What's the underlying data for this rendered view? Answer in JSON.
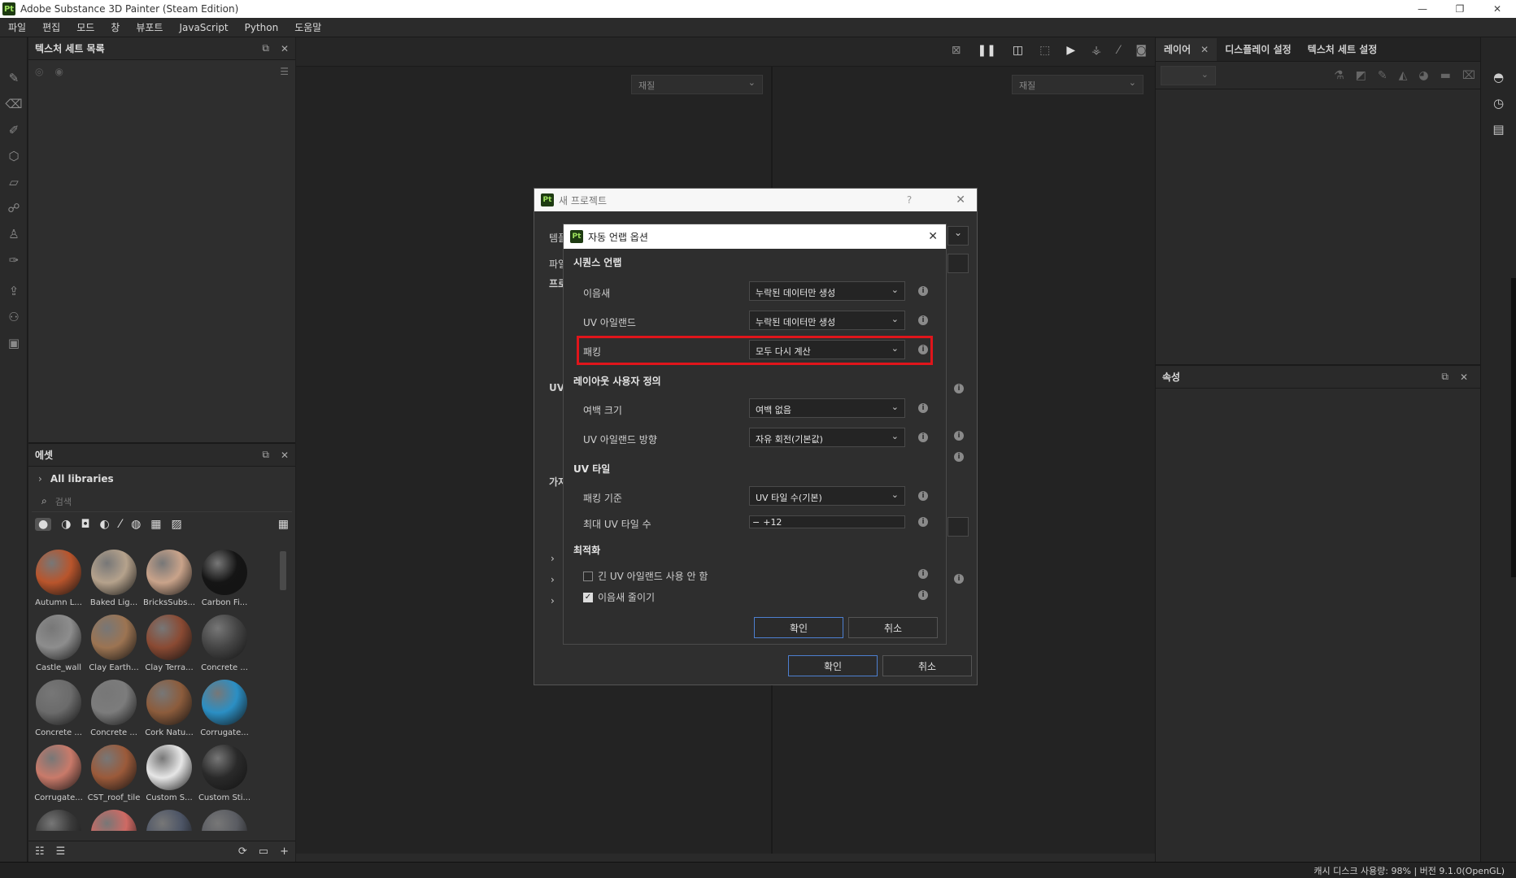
{
  "window": {
    "title": "Adobe Substance 3D Painter (Steam Edition)",
    "logo": "Pt",
    "min": "—",
    "max": "❐",
    "close": "✕"
  },
  "menu": [
    "파일",
    "편집",
    "모드",
    "창",
    "뷰포트",
    "JavaScript",
    "Python",
    "도움말"
  ],
  "texture_set_panel": {
    "title": "텍스처 세트 목록"
  },
  "assets_panel": {
    "title": "에셋",
    "libraries": "All libraries",
    "search_placeholder": "검색",
    "items": [
      {
        "label": "Autumn L...",
        "color": "#b9552c"
      },
      {
        "label": "Baked Lig...",
        "color": "#b5a28c"
      },
      {
        "label": "BricksSubs...",
        "color": "#c9a38a"
      },
      {
        "label": "Carbon Fi...",
        "color": "#151515"
      },
      {
        "label": "Castle_wall",
        "color": "#8d8d8d"
      },
      {
        "label": "Clay Earth...",
        "color": "#9c7452"
      },
      {
        "label": "Clay Terra...",
        "color": "#8a4a33"
      },
      {
        "label": "Concrete ...",
        "color": "#454545"
      },
      {
        "label": "Concrete ...",
        "color": "#6b6b6b"
      },
      {
        "label": "Concrete ...",
        "color": "#7c7c7c"
      },
      {
        "label": "Cork Natu...",
        "color": "#8c5c3c"
      },
      {
        "label": "Corrugate...",
        "color": "#2b8fc4"
      },
      {
        "label": "Corrugate...",
        "color": "#c97a6a"
      },
      {
        "label": "CST_roof_tile",
        "color": "#9b5a3a"
      },
      {
        "label": "Custom S...",
        "color": "#e6e6e6"
      },
      {
        "label": "Custom Sti...",
        "color": "#2a2a2a"
      },
      {
        "label": "",
        "color": "#3a3a3a"
      },
      {
        "label": "",
        "color": "#cf6a64"
      },
      {
        "label": "",
        "color": "#4d5566"
      },
      {
        "label": "",
        "color": "#5a5c62"
      }
    ]
  },
  "viewport": {
    "left_select": "재질",
    "right_select": "재질"
  },
  "right_panel": {
    "tabs": [
      "레이어",
      "디스플레이 설정",
      "텍스처 세트 설정"
    ],
    "properties_title": "속성"
  },
  "outer_dialog": {
    "title": "새 프로젝트",
    "help": "?",
    "partial_labels": [
      "템플",
      "파일",
      "프로",
      "UV",
      "가져"
    ],
    "ok": "확인",
    "cancel": "취소"
  },
  "inner_dialog": {
    "title": "자동 언랩 옵션",
    "sections": {
      "seq": "시퀀스 언랩",
      "layout": "레이아웃 사용자 정의",
      "tile": "UV 타일",
      "opt": "최적화"
    },
    "rows": {
      "seam": {
        "label": "이음새",
        "value": "누락된 데이터만 생성"
      },
      "island": {
        "label": "UV 아일랜드",
        "value": "누락된 데이터만 생성"
      },
      "packing": {
        "label": "패킹",
        "value": "모두 다시 계산"
      },
      "margin": {
        "label": "여백 크기",
        "value": "여백 없음"
      },
      "orient": {
        "label": "UV 아일랜드 방향",
        "value": "자유 회전(기본값)"
      },
      "packby": {
        "label": "패킹 기준",
        "value": "UV 타일 수(기본)"
      },
      "maxtiles": {
        "label": "최대 UV 타일 수",
        "value": "12"
      }
    },
    "checkboxes": [
      {
        "label": "긴 UV 아일랜드 사용 안 함",
        "checked": false
      },
      {
        "label": "이음새 줄이기",
        "checked": true
      }
    ],
    "ok": "확인",
    "cancel": "취소",
    "highlight_color": "#e0151b"
  },
  "status": {
    "text": "캐시 디스크 사용량:  98% | 버전 9.1.0(OpenGL)"
  }
}
